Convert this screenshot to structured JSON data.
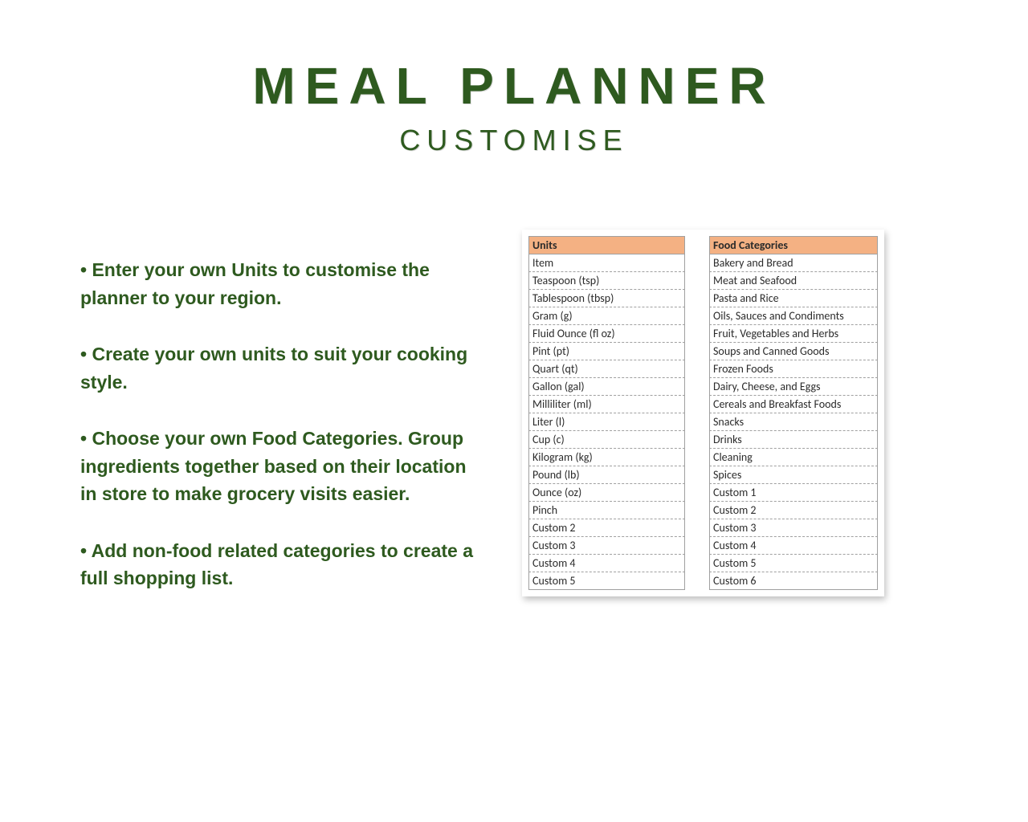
{
  "title": "MEAL PLANNER",
  "subtitle": "CUSTOMISE",
  "bullets": [
    "Enter your own Units to customise the planner to your region.",
    "Create your own units to suit your cooking style.",
    "Choose your own Food Categories. Group ingredients together based on their location in store to make grocery visits easier.",
    "Add non-food related categories to create a full shopping list."
  ],
  "tables": {
    "units": {
      "header": "Units",
      "rows": [
        "Item",
        "Teaspoon (tsp)",
        "Tablespoon (tbsp)",
        "Gram (g)",
        "Fluid Ounce (fl oz)",
        "Pint (pt)",
        "Quart (qt)",
        "Gallon (gal)",
        "Milliliter (ml)",
        "Liter (l)",
        "Cup (c)",
        "Kilogram (kg)",
        "Pound (lb)",
        "Ounce (oz)",
        "Pinch",
        "Custom 2",
        "Custom 3",
        "Custom 4",
        "Custom 5"
      ]
    },
    "food_categories": {
      "header": "Food Categories",
      "rows": [
        "Bakery and Bread",
        "Meat and Seafood",
        "Pasta and Rice",
        "Oils, Sauces and Condiments",
        "Fruit, Vegetables and Herbs",
        "Soups and Canned Goods",
        "Frozen Foods",
        "Dairy, Cheese, and Eggs",
        "Cereals and Breakfast Foods",
        "Snacks",
        "Drinks",
        "Cleaning",
        "Spices",
        "Custom 1",
        "Custom 2",
        "Custom 3",
        "Custom 4",
        "Custom 5",
        "Custom 6"
      ]
    }
  }
}
